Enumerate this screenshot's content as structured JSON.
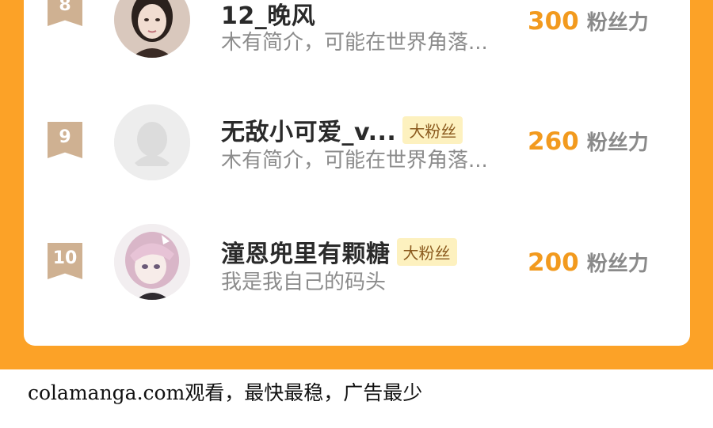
{
  "leaderboard": {
    "unit_label": "粉丝力",
    "rows": [
      {
        "rank": "8",
        "name": "12_晚风",
        "intro": "木有简介，可能在世界角落...",
        "score": "300",
        "badge": ""
      },
      {
        "rank": "9",
        "name": "无敌小可爱_v...",
        "intro": "木有简介，可能在世界角落...",
        "score": "260",
        "badge": "大粉丝"
      },
      {
        "rank": "10",
        "name": "潼恩兜里有颗糖",
        "intro": "我是我自己的码头",
        "score": "200",
        "badge": "大粉丝"
      }
    ]
  },
  "footer": {
    "text": "colamanga.com观看，最快最稳，广告最少"
  },
  "colors": {
    "accent_orange": "#FCA227",
    "score_orange": "#F29A1E",
    "rank_flag": "#CFB192",
    "badge_bg": "#FDF1BF"
  }
}
